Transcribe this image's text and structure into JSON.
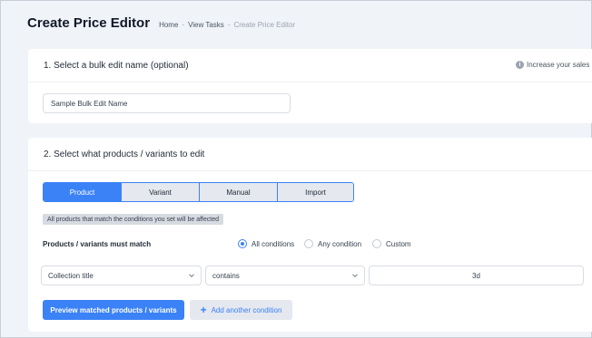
{
  "header": {
    "title": "Create Price Editor",
    "breadcrumb": [
      {
        "label": "Home"
      },
      {
        "label": "View Tasks"
      },
      {
        "label": "Create Price Editor"
      }
    ],
    "separator": "-"
  },
  "section1": {
    "title": "1. Select a bulk edit name (optional)",
    "hint": "Increase your sales",
    "hint_icon": "info-icon",
    "name_input": {
      "value": "Sample Bulk Edit Name",
      "placeholder": ""
    }
  },
  "section2": {
    "title": "2. Select what products / variants to edit",
    "tabs": [
      {
        "label": "Product",
        "active": true
      },
      {
        "label": "Variant",
        "active": false
      },
      {
        "label": "Manual",
        "active": false
      },
      {
        "label": "Import",
        "active": false
      }
    ],
    "note": "All products that match the conditions you set will be affected",
    "match_label": "Products / variants must match",
    "match_options": [
      {
        "label": "All conditions",
        "checked": true
      },
      {
        "label": "Any condition",
        "checked": false
      },
      {
        "label": "Custom",
        "checked": false
      }
    ],
    "condition": {
      "field": "Collection title",
      "operator": "contains",
      "value": "3d"
    },
    "preview_button": "Preview matched products / variants",
    "add_condition_button": "Add another condition"
  },
  "colors": {
    "accent": "#3b82f6",
    "background": "#f0f3f8"
  }
}
